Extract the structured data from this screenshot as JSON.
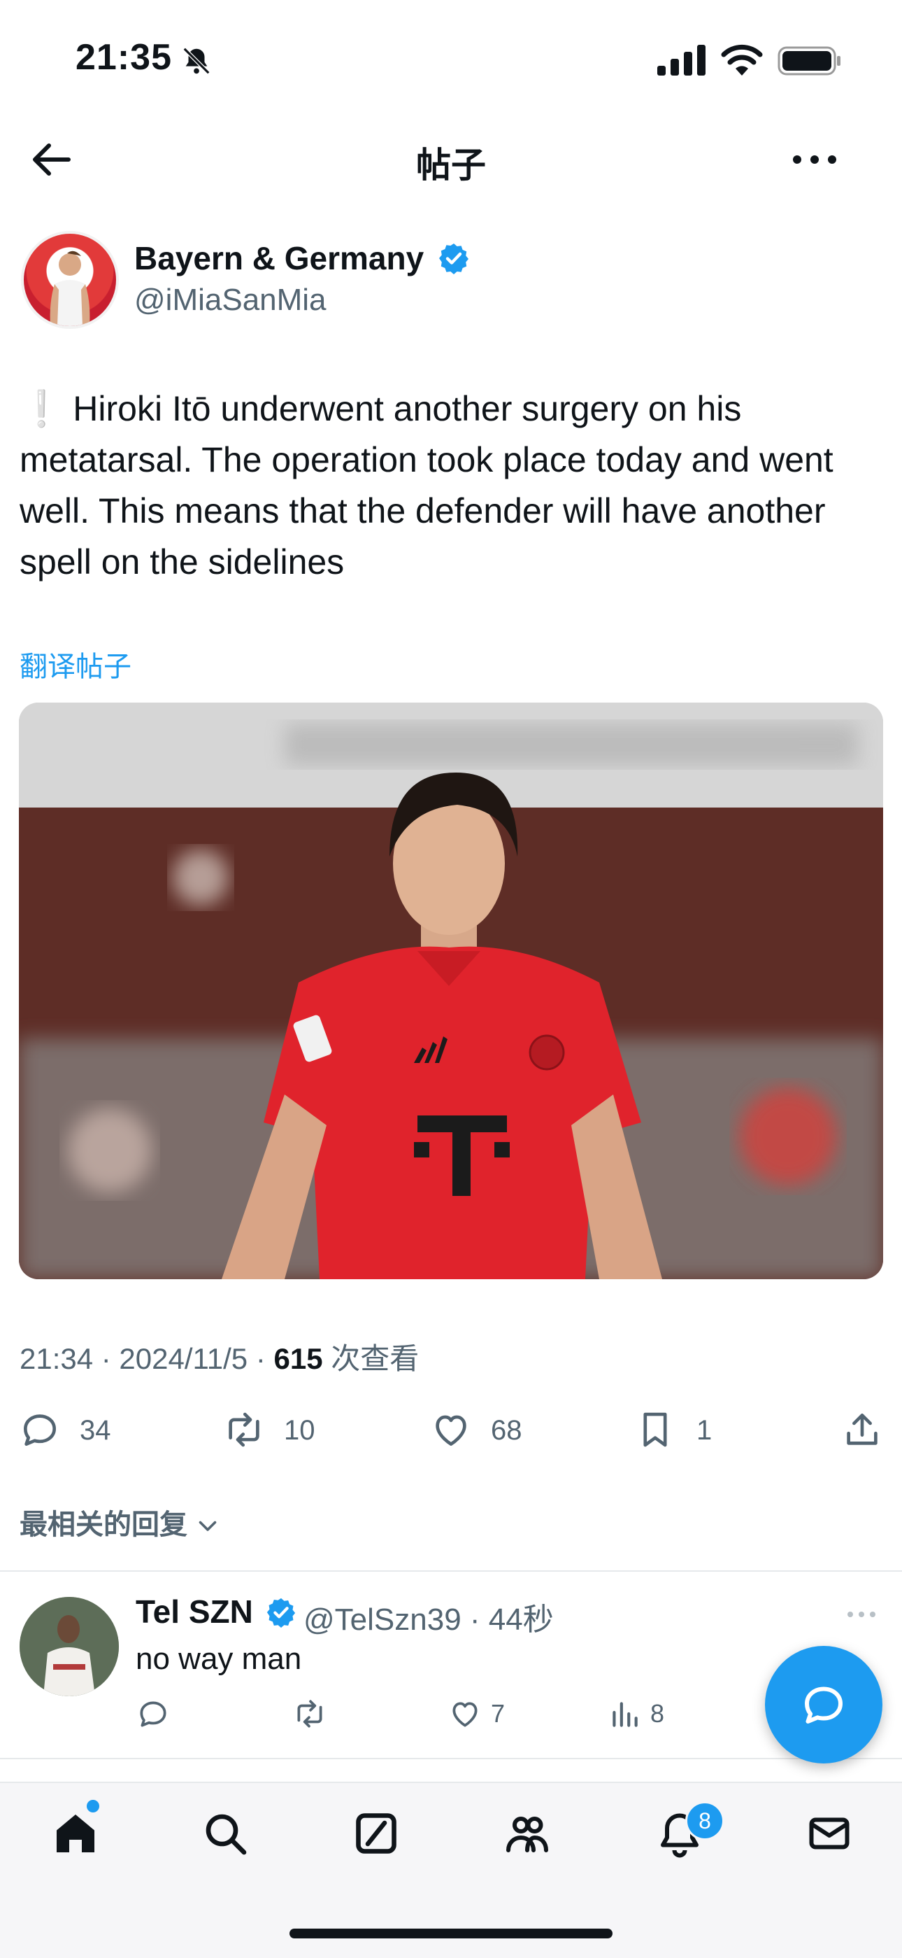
{
  "status_bar": {
    "time": "21:35",
    "icons": [
      "bell-slash-icon",
      "signal-icon",
      "wifi-icon",
      "battery-icon"
    ]
  },
  "nav": {
    "title": "帖子",
    "back_icon": "arrow-left-icon",
    "more_icon": "more-horizontal-icon"
  },
  "post": {
    "author_name": "Bayern & Germany",
    "author_handle": "@iMiaSanMia",
    "lead_symbol": "❕",
    "text": "Hiroki Itō underwent another surgery on his metatarsal. The operation took place today and went well. This means that the defender will have another spell on the sidelines",
    "translate_label": "翻译帖子",
    "meta_prefix": "21:34 · 2024/11/5 · ",
    "views_count": "615",
    "views_label": " 次查看",
    "actions": {
      "replies": "34",
      "reposts": "10",
      "likes": "68",
      "bookmarks": "1"
    }
  },
  "replies_sort_label": "最相关的回复",
  "reply": {
    "name": "Tel SZN",
    "handle_time": "@TelSzn39 · 44秒",
    "text": "no way man",
    "likes": "7",
    "views": "8"
  },
  "tabbar": {
    "items": [
      "home-icon",
      "search-icon",
      "grok-icon",
      "communities-icon",
      "notifications-icon",
      "messages-icon"
    ],
    "notifications_badge": "8"
  },
  "colors": {
    "accent": "#1d9bf0",
    "text": "#0f1419",
    "secondary": "#536471"
  }
}
